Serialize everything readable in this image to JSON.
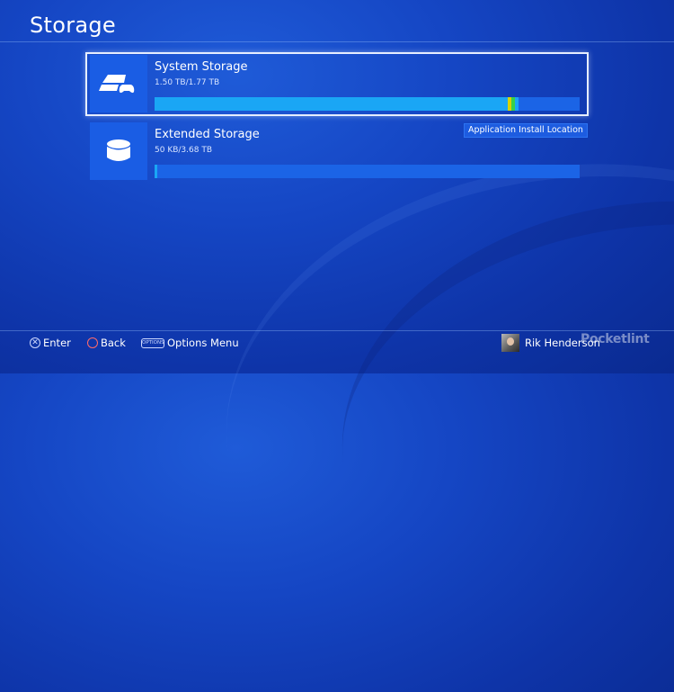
{
  "header": {
    "title": "Storage"
  },
  "storage_items": [
    {
      "label": "System Storage",
      "usage": "1.50 TB/1.77 TB",
      "used_fraction": 0.83,
      "icon": "ps4-console-icon",
      "focused": true
    },
    {
      "label": "Extended Storage",
      "usage": "50 KB/3.68 TB",
      "used_fraction": 0.005,
      "icon": "external-drive-icon",
      "focused": false
    }
  ],
  "install_tag": "Application Install Location",
  "footer": {
    "enter": {
      "glyph": "✕",
      "label": "Enter"
    },
    "back": {
      "glyph": "○",
      "label": "Back"
    },
    "options": {
      "glyph": "OPTIONS",
      "label": "Options Menu"
    },
    "user": {
      "name": "Rik Henderson"
    }
  },
  "watermark": "Pocketlint",
  "colors": {
    "background": "#1546c4",
    "bar_track": "#1b64e6",
    "bar_fill": "#1aa6f5"
  }
}
